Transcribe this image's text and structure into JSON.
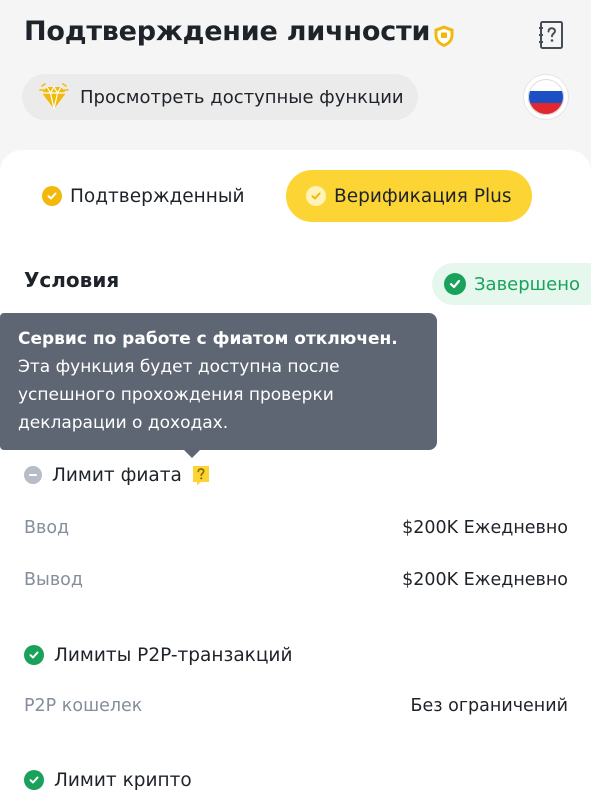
{
  "header": {
    "title": "Подтверждение личности",
    "features_label": "Просмотреть доступные функции"
  },
  "tabs": [
    {
      "label": "Подтвержденный",
      "active": false
    },
    {
      "label": "Верификация Plus",
      "active": true
    }
  ],
  "conditions": {
    "title": "Условия",
    "status": "Завершено"
  },
  "tooltip": {
    "bold": "Сервис по работе с фиатом отключен.",
    "text": " Эта функция будет доступна после успешного прохождения проверки декларации о доходах."
  },
  "limits": {
    "fiat": {
      "title": "Лимит фиата",
      "rows": [
        {
          "label": "Ввод",
          "value": "$200K Ежедневно"
        },
        {
          "label": "Вывод",
          "value": "$200K Ежедневно"
        }
      ]
    },
    "p2p": {
      "title": "Лимиты P2P-транзакций",
      "rows": [
        {
          "label": "P2P кошелек",
          "value": "Без ограничений"
        }
      ]
    },
    "crypto": {
      "title": "Лимит крипто"
    }
  },
  "colors": {
    "accent": "#fcd535",
    "brand_gold": "#f0b90b",
    "success": "#1aa25c",
    "tooltip_bg": "#5e6673"
  },
  "icons": {
    "verified_badge": "shield-icon",
    "help": "help-book-icon",
    "features": "diamond-icon",
    "flag": "russia-flag-icon",
    "disabled": "minus-circle-icon",
    "completed": "check-circle-icon",
    "info": "question-bubble-icon"
  }
}
